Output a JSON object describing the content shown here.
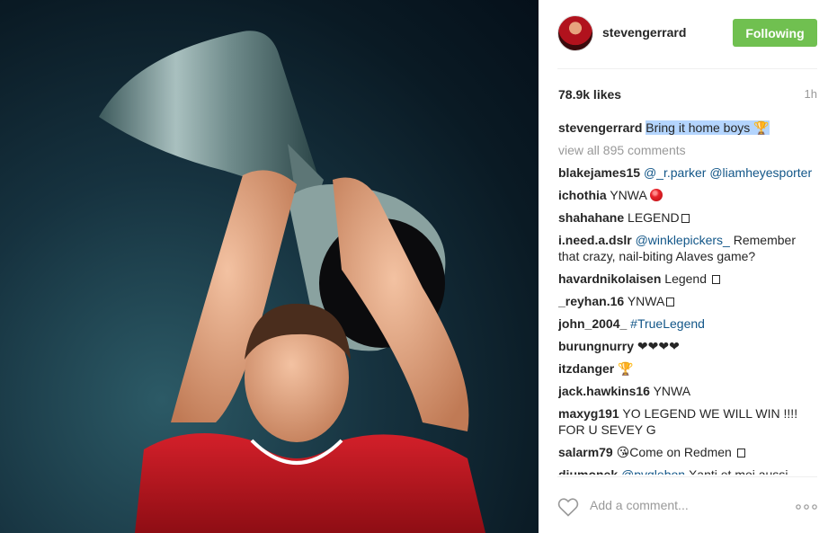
{
  "post": {
    "username": "stevengerrard",
    "follow_label": "Following",
    "likes": "78.9k likes",
    "time": "1h",
    "caption_user": "stevengerrard",
    "caption_text": "Bring it home boys",
    "caption_emoji": "🏆",
    "view_all": "view all 895 comments"
  },
  "comments": [
    {
      "user": "blakejames15",
      "parts": [
        {
          "t": "@_r.parker @liamheyesporter",
          "cls": "mention"
        }
      ]
    },
    {
      "user": "ichothia",
      "parts": [
        {
          "t": "YNWA "
        },
        {
          "t": "",
          "cls": "ball"
        }
      ]
    },
    {
      "user": "shahahane",
      "parts": [
        {
          "t": "LEGEND"
        },
        {
          "t": "",
          "cls": "box"
        }
      ]
    },
    {
      "user": "i.need.a.dslr",
      "parts": [
        {
          "t": "@winklepickers_",
          "cls": "mention"
        },
        {
          "t": " Remember that crazy, nail-biting Alaves game?"
        }
      ]
    },
    {
      "user": "havardnikolaisen",
      "parts": [
        {
          "t": "Legend "
        },
        {
          "t": "",
          "cls": "box"
        }
      ]
    },
    {
      "user": "_reyhan.16",
      "parts": [
        {
          "t": "YNWA"
        },
        {
          "t": "",
          "cls": "box"
        }
      ]
    },
    {
      "user": "john_2004_",
      "parts": [
        {
          "t": "#TrueLegend",
          "cls": "mention"
        }
      ]
    },
    {
      "user": "burungnurry",
      "parts": [
        {
          "t": "❤❤❤❤"
        }
      ]
    },
    {
      "user": "itzdanger",
      "parts": [
        {
          "t": "🏆"
        }
      ]
    },
    {
      "user": "jack.hawkins16",
      "parts": [
        {
          "t": "YNWA"
        }
      ]
    },
    {
      "user": "maxyg191",
      "parts": [
        {
          "t": "YO LEGEND WE WILL WIN !!!! FOR U SEVEY G"
        }
      ]
    },
    {
      "user": "salarm79",
      "parts": [
        {
          "t": "😘Come on Redmen "
        },
        {
          "t": "",
          "cls": "box"
        }
      ]
    },
    {
      "user": "djumonek",
      "parts": [
        {
          "t": "@pvglebon",
          "cls": "mention"
        },
        {
          "t": " Xanti et moi aussi"
        }
      ]
    }
  ],
  "footer": {
    "add_comment_placeholder": "Add a comment...",
    "like_icon": "heart-icon",
    "more_icon": "more-options-icon"
  },
  "colors": {
    "follow_green": "#70c050",
    "mention_blue": "#125688",
    "highlight": "#b4d5fe"
  }
}
